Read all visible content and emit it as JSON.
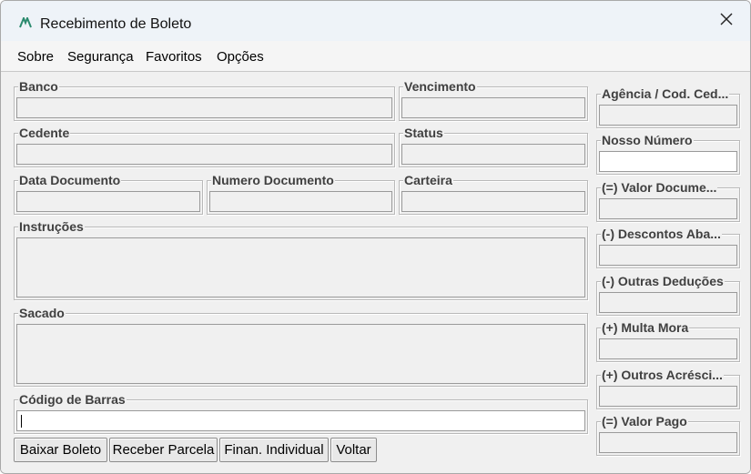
{
  "window": {
    "title": "Recebimento de Boleto"
  },
  "menu": {
    "sobre": "Sobre",
    "seguranca": "Segurança",
    "favoritos": "Favoritos",
    "opcoes": "Opções"
  },
  "fields": {
    "banco": {
      "label": "Banco",
      "value": ""
    },
    "vencimento": {
      "label": "Vencimento",
      "value": ""
    },
    "cedente": {
      "label": "Cedente",
      "value": ""
    },
    "status": {
      "label": "Status",
      "value": ""
    },
    "data_documento": {
      "label": "Data Documento",
      "value": ""
    },
    "numero_documento": {
      "label": "Numero Documento",
      "value": ""
    },
    "carteira": {
      "label": "Carteira",
      "value": ""
    },
    "instrucoes": {
      "label": "Instruções",
      "value": ""
    },
    "sacado": {
      "label": "Sacado",
      "value": ""
    },
    "codigo_barras": {
      "label": "Código de Barras",
      "value": ""
    }
  },
  "right_fields": {
    "agencia": {
      "label": "Agência / Cod. Ced...",
      "value": ""
    },
    "nosso_numero": {
      "label": "Nosso Número",
      "value": ""
    },
    "valor_documento": {
      "label": "(=) Valor Docume...",
      "value": ""
    },
    "descontos": {
      "label": "(-) Descontos Aba...",
      "value": ""
    },
    "outras_deducoes": {
      "label": "(-) Outras Deduções",
      "value": ""
    },
    "multa_mora": {
      "label": "(+) Multa Mora",
      "value": ""
    },
    "outros_acrescimos": {
      "label": "(+) Outros Acrésci...",
      "value": ""
    },
    "valor_pago": {
      "label": "(=) Valor Pago",
      "value": ""
    }
  },
  "buttons": {
    "baixar": "Baixar Boleto",
    "receber": "Receber Parcela",
    "finan": "Finan. Individual",
    "voltar": "Voltar"
  },
  "icons": {
    "app": "app-logo-icon",
    "close": "close-icon"
  }
}
